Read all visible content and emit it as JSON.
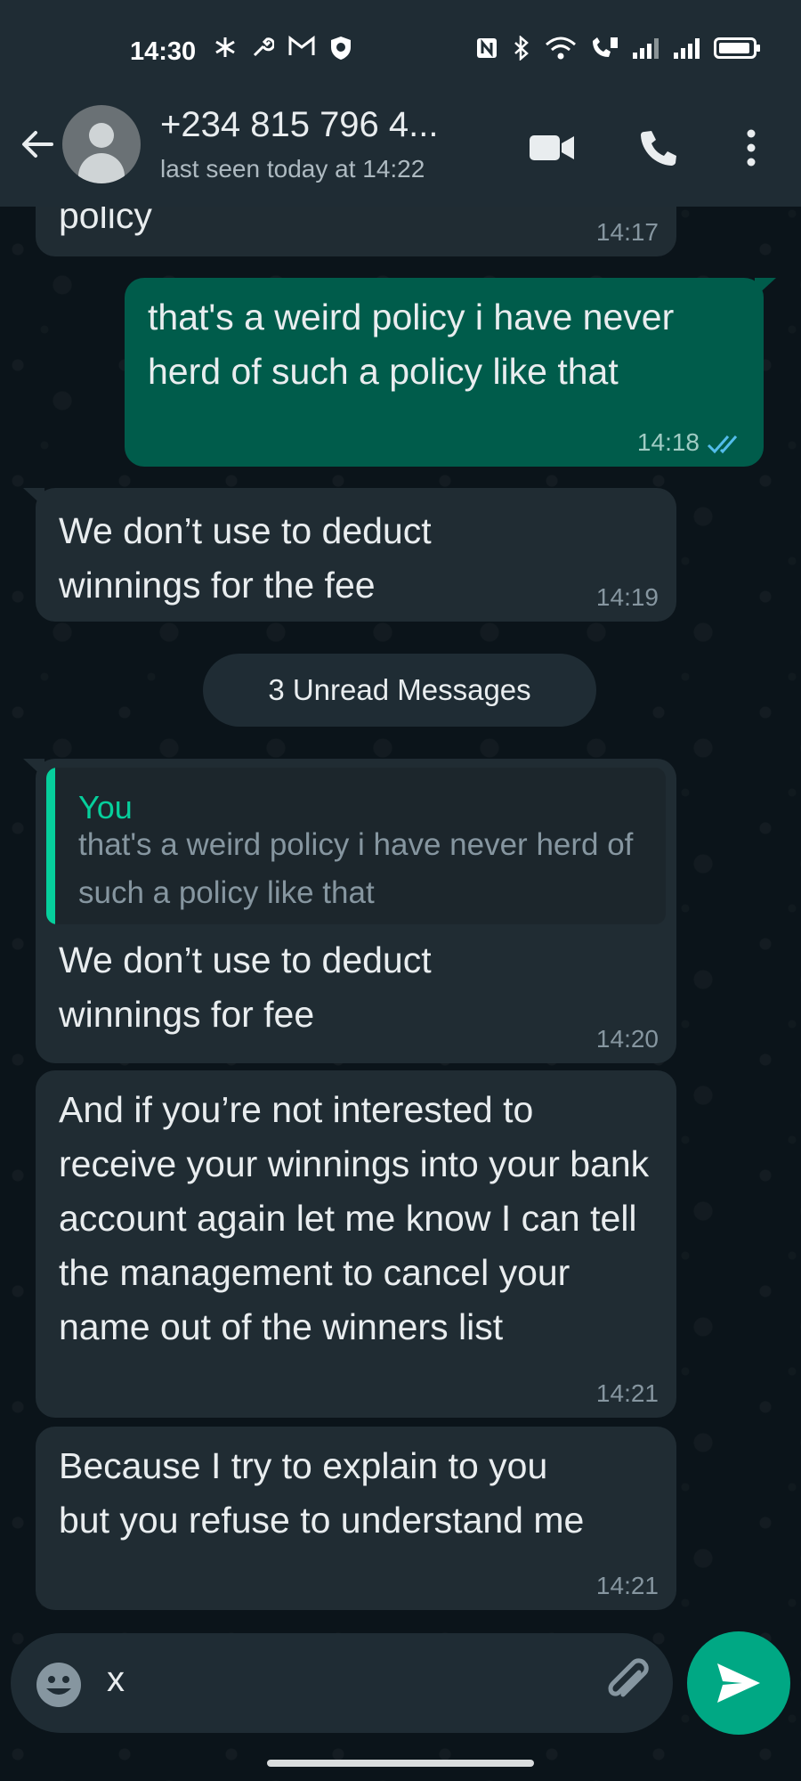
{
  "status": {
    "time": "14:30",
    "left_icons": [
      "asterisk-icon",
      "wrench-icon",
      "gmail-icon",
      "shield-icon"
    ],
    "right_icons": [
      "nfc-icon",
      "bluetooth-icon",
      "wifi-icon",
      "volte-icon",
      "signal-icon",
      "signal-icon",
      "battery-icon"
    ]
  },
  "header": {
    "contact_name": "+234 815 796 4...",
    "last_seen": "last seen today at 14:22"
  },
  "messages": [
    {
      "id": "m0",
      "direction": "in",
      "text": "policy",
      "time": "14:17"
    },
    {
      "id": "m1",
      "direction": "out",
      "text": "that's a weird policy i have never herd of such a policy like that",
      "time": "14:18",
      "read": true
    },
    {
      "id": "m2",
      "direction": "in",
      "text": "We don’t use to deduct winnings for the fee",
      "time": "14:19"
    },
    {
      "id": "m3",
      "direction": "in",
      "quote_author": "You",
      "quote_text": "that's a weird policy i have never herd of such a policy like that",
      "text": "We don’t use to deduct winnings for fee",
      "time": "14:20"
    },
    {
      "id": "m4",
      "direction": "in",
      "text": "And if you’re not interested to receive your winnings into your bank account again let me know I can tell the management to cancel your name out of the winners list",
      "time": "14:21"
    },
    {
      "id": "m5",
      "direction": "in",
      "text": "Because I try to explain to you but you refuse to understand me",
      "time": "14:21"
    }
  ],
  "unread_banner": "3 Unread Messages",
  "composer": {
    "typed_text": "x"
  },
  "colors": {
    "background": "#0b141a",
    "header": "#1f2c34",
    "incoming_bubble": "#202c33",
    "outgoing_bubble": "#005c4b",
    "accent": "#00a884",
    "read_ticks": "#53bdeb"
  }
}
